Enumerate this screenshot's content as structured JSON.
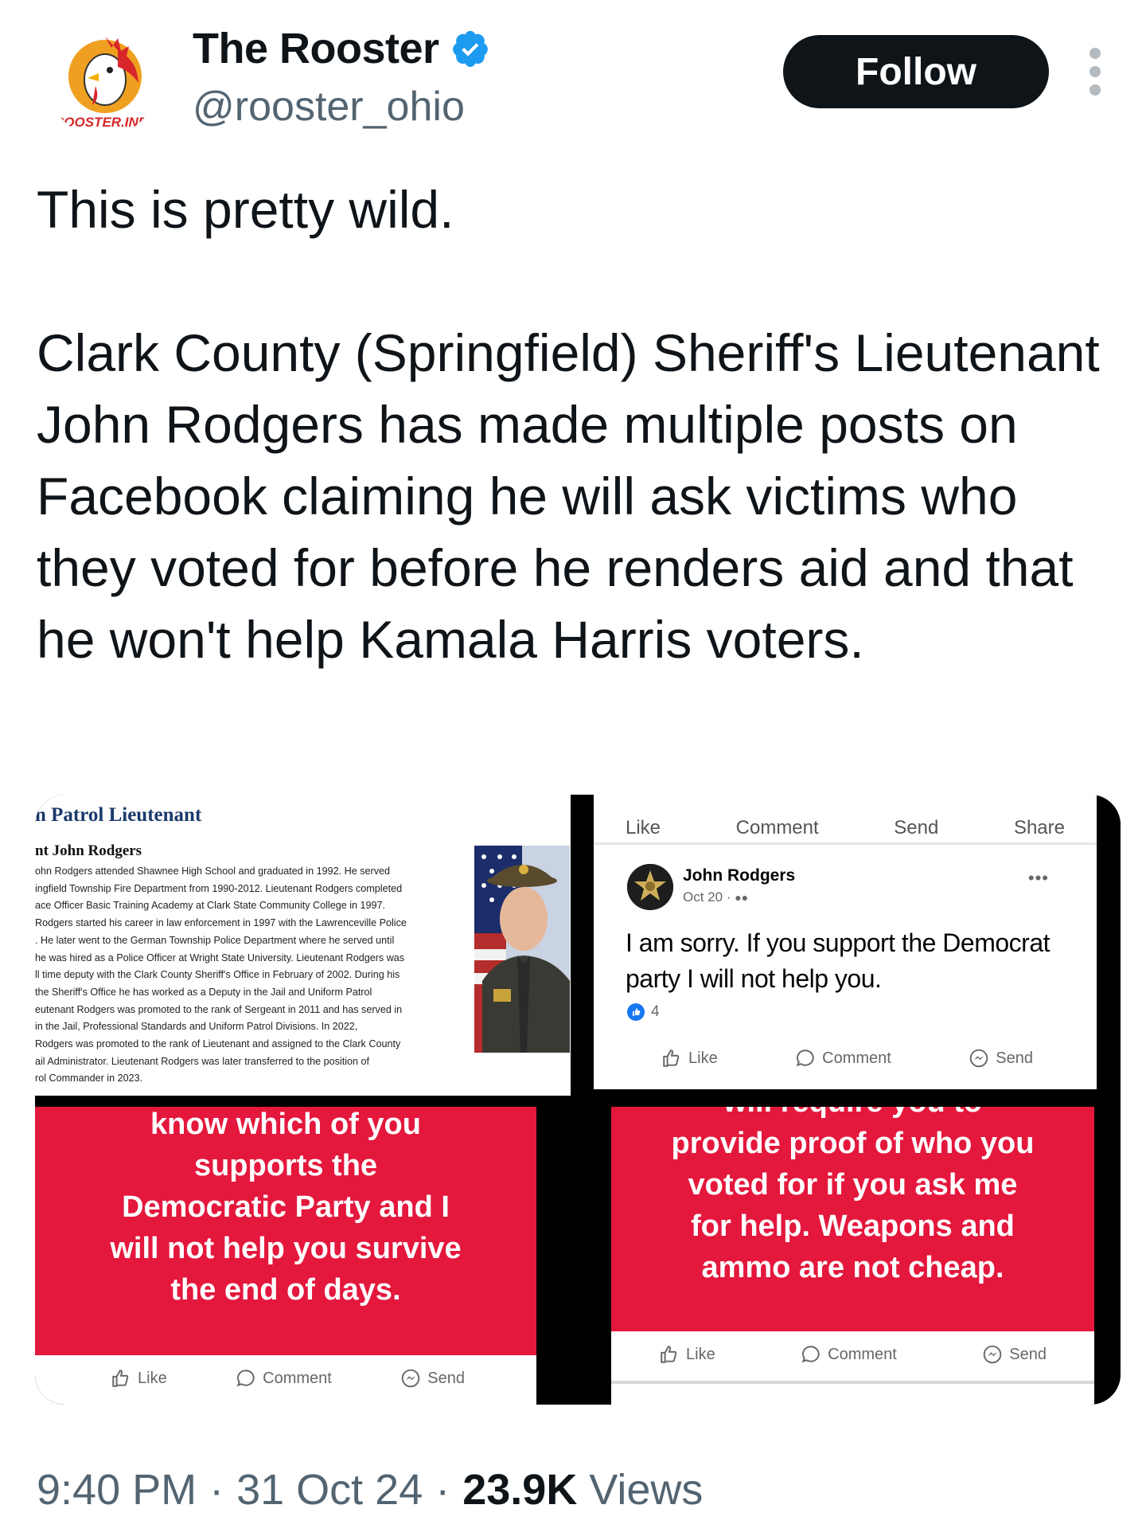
{
  "account": {
    "display_name": "The Rooster",
    "handle": "@rooster_ohio",
    "avatar_label": "ROOSTER.INFO",
    "follow_label": "Follow"
  },
  "tweet": {
    "line1": "This is pretty wild.",
    "body": "Clark County (Springfield) Sheriff's Lieutenant John Rodgers has made multiple posts on Facebook claiming he will ask victims who they voted for before he renders aid and that he won't help Kamala Harris voters."
  },
  "media": {
    "bio": {
      "title": "n Patrol Lieutenant",
      "name": "nt John Rodgers",
      "text": "ohn Rodgers attended Shawnee High School and graduated in 1992. He served\ningfield Township Fire Department from 1990-2012. Lieutenant Rodgers completed\nace Officer Basic Training Academy at Clark State Community College in 1997.\nRodgers started his career in law enforcement in 1997 with the Lawrenceville Police\n. He later went to the German Township Police Department where he served until\nhe was hired as a Police Officer at Wright State University. Lieutenant Rodgers was\nll time deputy with the Clark County Sheriff's Office in February of 2002. During his\nthe Sheriff's Office he has worked as a Deputy in the Jail and Uniform Patrol\neutenant Rodgers was promoted to the rank of Sergeant in 2011 and has served in\n in the Jail, Professional Standards and Uniform Patrol Divisions. In 2022,\nRodgers was promoted to the rank of Lieutenant and assigned to the Clark County\nail Administrator. Lieutenant Rodgers was later transferred to the position of\nrol Commander in 2023."
    },
    "fb_post": {
      "cut_actions": [
        "Like",
        "Comment",
        "Send",
        "Share"
      ],
      "author": "John Rodgers",
      "date": "Oct 20 · ",
      "more": "•••",
      "text": "I am sorry. If you support the Democrat party I will not help you.",
      "reactions": "4",
      "actions": [
        "Like",
        "Comment",
        "Send"
      ]
    },
    "red_post_1": {
      "text_lines": [
        "know which of you",
        "supports the",
        "Democratic Party and I",
        "will not help you survive",
        "the end of days."
      ],
      "actions": [
        "Like",
        "Comment",
        "Send"
      ]
    },
    "red_post_2": {
      "text_lines": [
        "will require you to",
        "provide proof of who you",
        "voted for if you ask me",
        "for help. Weapons and",
        "ammo are not cheap."
      ],
      "actions": [
        "Like",
        "Comment",
        "Send"
      ]
    }
  },
  "footer": {
    "time": "9:40 PM",
    "sep1": "·",
    "date": "31 Oct 24",
    "sep2": "·",
    "views_count": "23.9K",
    "views_label": "Views"
  },
  "colors": {
    "verified": "#1d9bf0",
    "fb_red": "#e4173d",
    "fb_blue": "#1877f2",
    "secondary_text": "#536471"
  }
}
